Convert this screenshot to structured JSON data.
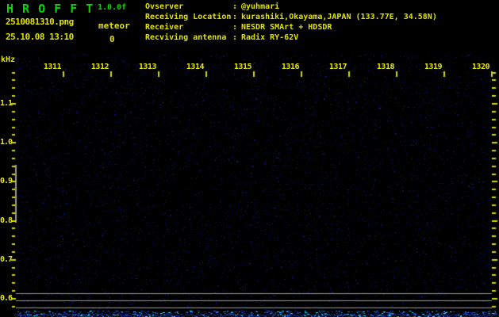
{
  "header": {
    "app_title": "H R O F F T",
    "version": "1.0.0f",
    "filename": "2510081310.png",
    "timestamp": "25.10.08 13:10",
    "meteor_label": "meteor",
    "meteor_count": "0",
    "colon": ":",
    "info_rows": [
      {
        "label": "Ovserver",
        "value": "@yuhmari"
      },
      {
        "label": "Receiving Location",
        "value": "kurashiki,Okayama,JAPAN (133.77E, 34.58N)"
      },
      {
        "label": "Receiver",
        "value": "NESDR SMArt + HDSDR"
      },
      {
        "label": "Recviving antenna",
        "value": "Radix RY-62V"
      }
    ]
  },
  "chart_data": {
    "type": "heatmap",
    "title": "",
    "ylabel": "kHz",
    "x_tick_labels": [
      "1311",
      "1312",
      "1313",
      "1314",
      "1315",
      "1316",
      "1317",
      "1318",
      "1319",
      "1320"
    ],
    "y_tick_labels": [
      "1.1",
      "1.0",
      "0.9",
      "0.8",
      "0.7",
      "0.6"
    ],
    "y_minor_ticks_per_major": 5,
    "ylim": [
      0.58,
      1.18
    ],
    "grid": false,
    "meteor_count": 0,
    "series": [
      {
        "name": "meteor-echoes",
        "points": []
      },
      {
        "name": "background-noise",
        "description": "sparse dark-blue noise pixels across the whole band, no echoes visible"
      },
      {
        "name": "signal-level-trace",
        "description": "bright blue/cyan noise-level trace along the bottom edge"
      }
    ],
    "reference_lines_y_khz": [
      0.615,
      0.6,
      0.58
    ]
  },
  "colors": {
    "background": "#000000",
    "title_green": "#00d800",
    "text_yellow": "#e2e200",
    "tick_yellow": "#d8d800",
    "gray_line": "#9a9a9a",
    "noise_blue": "#2233bb",
    "trace_cyan": "#19e2ff",
    "trace_blue": "#2f6fe0"
  }
}
